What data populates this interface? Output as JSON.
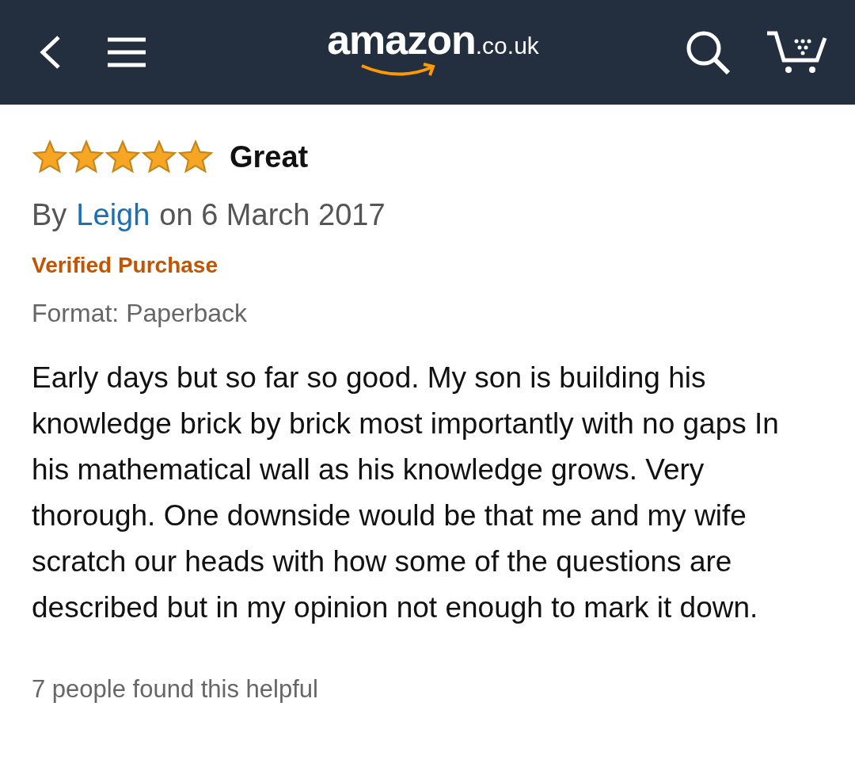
{
  "header": {
    "logo": "amazon",
    "logo_domain": ".co.uk"
  },
  "review": {
    "stars": 5,
    "title": "Great",
    "by_prefix": "By",
    "author": "Leigh",
    "date": "on 6 March 2017",
    "verified": "Verified Purchase",
    "format": "Format: Paperback",
    "body": "Early days but so far so good. My son is building his knowledge brick by brick most importantly with no gaps In his mathematical wall as his knowledge grows. Very thorough. One downside would be that me and my wife scratch our heads with how some of the questions are described but in my opinion not enough to mark it down.",
    "helpful": "7 people found this helpful"
  }
}
